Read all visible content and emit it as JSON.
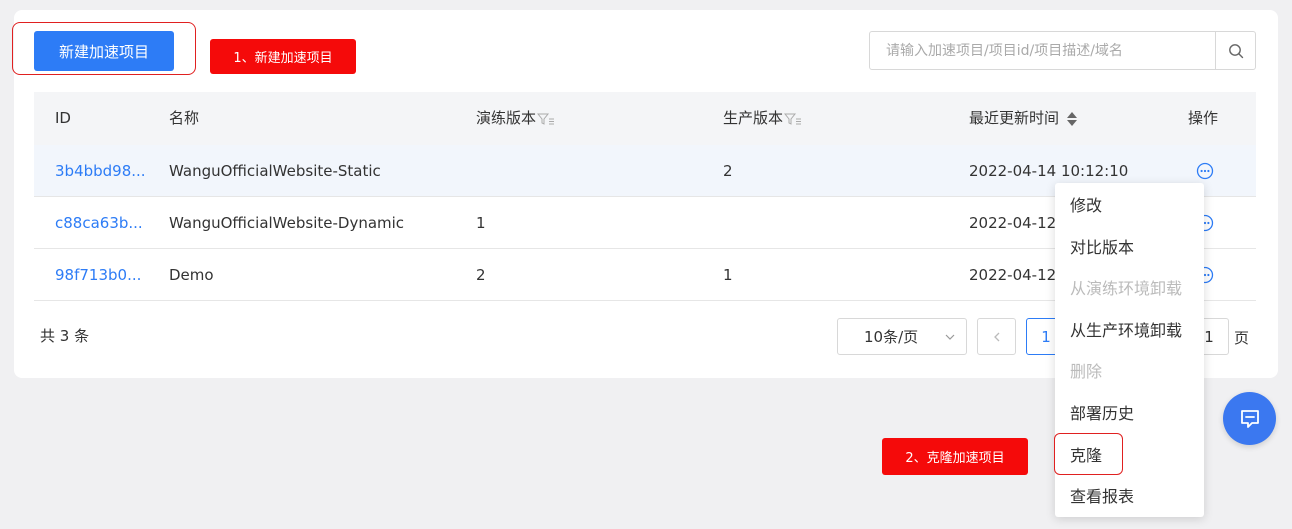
{
  "toolbar": {
    "new_button_label": "新建加速项目"
  },
  "annotations": {
    "callout1": "1、新建加速项目",
    "callout2": "2、克隆加速项目"
  },
  "search": {
    "placeholder": "请输入加速项目/项目id/项目描述/域名",
    "icon": "search-icon"
  },
  "table": {
    "headers": {
      "id": "ID",
      "name": "名称",
      "rehearsal": "演练版本",
      "production": "生产版本",
      "updated": "最近更新时间",
      "action": "操作"
    },
    "rows": [
      {
        "id": "3b4bbd98...",
        "name": "WanguOfficialWebsite-Static",
        "rehearsal": "",
        "production": "2",
        "updated": "2022-04-14 10:12:10"
      },
      {
        "id": "c88ca63b...",
        "name": "WanguOfficialWebsite-Dynamic",
        "rehearsal": "1",
        "production": "",
        "updated": "2022-04-12"
      },
      {
        "id": "98f713b0...",
        "name": "Demo",
        "rehearsal": "2",
        "production": "1",
        "updated": "2022-04-12"
      }
    ]
  },
  "pagination": {
    "total": "共 3 条",
    "page_size": "10条/页",
    "current_page": "1",
    "jump_value": "1",
    "page_suffix": "页"
  },
  "action_menu": {
    "items": [
      {
        "label": "修改",
        "disabled": false
      },
      {
        "label": "对比版本",
        "disabled": false
      },
      {
        "label": "从演练环境卸载",
        "disabled": true
      },
      {
        "label": "从生产环境卸载",
        "disabled": false
      },
      {
        "label": "删除",
        "disabled": true
      },
      {
        "label": "部署历史",
        "disabled": false
      },
      {
        "label": "克隆",
        "disabled": false
      },
      {
        "label": "查看报表",
        "disabled": false
      }
    ]
  },
  "colors": {
    "primary": "#2d7cf6",
    "annotation_red": "#f50a0a",
    "chat_fab": "#3b78f0"
  }
}
